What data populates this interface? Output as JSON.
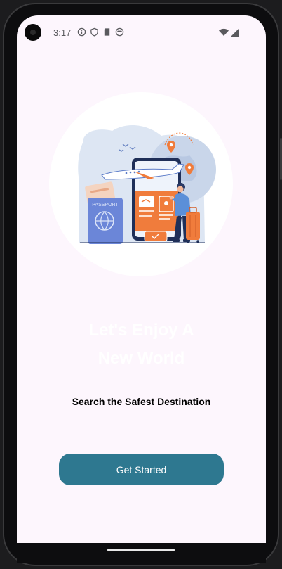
{
  "status_bar": {
    "time": "3:17",
    "icons": [
      "info-icon",
      "shield-icon",
      "sd-card-icon",
      "face-icon"
    ],
    "network_icons": [
      "wifi-icon",
      "signal-icon"
    ]
  },
  "hero": {
    "illustration": "travel-illustration",
    "passport_label": "PASSPORT"
  },
  "headline": {
    "line1": "Let's Enjoy A",
    "line2": "New World"
  },
  "subtitle": "Search the Safest Destination",
  "cta": {
    "label": "Get Started",
    "color": "#2e7890"
  },
  "colors": {
    "background": "#fdf6fd",
    "accent_orange": "#f07c3c",
    "accent_blue": "#4a6fd8"
  }
}
